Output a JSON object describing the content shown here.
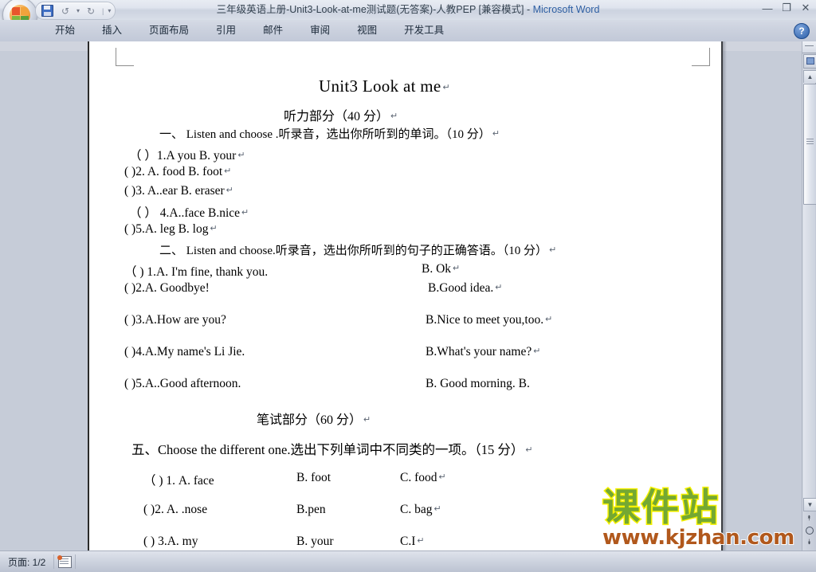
{
  "window": {
    "title_document": "三年级英语上册-Unit3-Look-at-me测试题(无答案)-人教PEP [兼容模式]",
    "title_separator": " - ",
    "title_app": "Microsoft Word",
    "minimize": "—",
    "restore": "❐",
    "close": "✕",
    "help": "?"
  },
  "quick_access": {
    "save": "save-icon",
    "undo": "↺",
    "undo_more": "▾",
    "redo": "↻",
    "customize": "▾"
  },
  "ribbon": {
    "tabs": [
      {
        "label": "开始"
      },
      {
        "label": "插入"
      },
      {
        "label": "页面布局"
      },
      {
        "label": "引用"
      },
      {
        "label": "邮件"
      },
      {
        "label": "审阅"
      },
      {
        "label": "视图"
      },
      {
        "label": "开发工具"
      }
    ]
  },
  "document": {
    "title": "Unit3      Look at me",
    "section_listening": "听力部分（40 分）",
    "q1_heading": "一、  Listen and choose .听录音，选出你所听到的单词。（10 分）",
    "q1_items": [
      "（      ）1.A you     B.    your",
      "(        )2. A. food       B. foot",
      "(      )3. A..ear            B. eraser",
      "（       ） 4.A..face        B.nice",
      "(      )5.A. leg           B. log"
    ],
    "q2_heading": "二、  Listen and choose.听录音，选出你所听到的句子的正确答语。（10 分）",
    "q2_items": [
      {
        "left": "（       ) 1.A. I'm fine, thank you.",
        "right": "B. Ok"
      },
      {
        "left": "(         )2.A. Goodbye!",
        "right": "B.Good idea."
      },
      {
        "left": "(         )3.A.How are you?",
        "right": "B.Nice to meet you,too."
      },
      {
        "left": "(         )4.A.My name's Li Jie.",
        "right": "B.What's your name?"
      },
      {
        "left": "(         )5.A..Good afternoon.",
        "right": "B. Good morning.     B."
      }
    ],
    "section_written": "笔试部分（60 分）",
    "q5_heading": "五、Choose the different one.选出下列单词中不同类的一项。（15 分）",
    "q5_items": [
      {
        "a": "（        ) 1. A. face",
        "b": "B. foot",
        "c": "C. food"
      },
      {
        "a": "(          )2. A. .nose",
        "b": "B.pen",
        "c": "C. bag"
      },
      {
        "a": "(        ) 3.A. my",
        "b": "B. your",
        "c": "C.I"
      }
    ],
    "pilcrow": "↵"
  },
  "watermark": {
    "brand_cn": "课件站",
    "url": "www.kjzhan.com",
    "brand_color": "#74a832",
    "brand_outline_color": "#f5f000",
    "url_color": "#b1581c"
  },
  "status_bar": {
    "page_label": "页面: 1/2",
    "doc_icon": "document-map-icon"
  },
  "scrollbar": {
    "up_arrow": "▲",
    "down_arrow": "▼",
    "prev_page": "⯭",
    "browse_object": "browse-object-icon",
    "next_page": "⯯",
    "split": "split-handle"
  }
}
